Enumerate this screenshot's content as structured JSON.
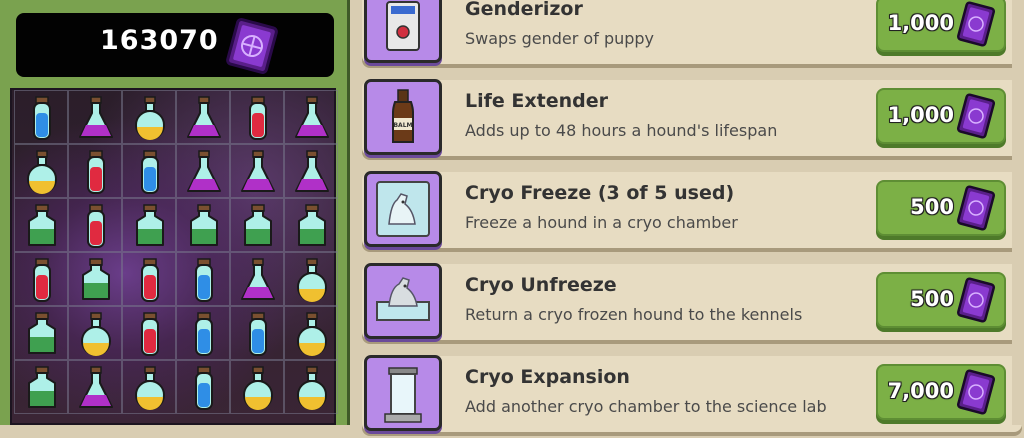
{
  "score": {
    "value": "163070",
    "currency_icon": "purple-card-icon"
  },
  "board": {
    "rows": [
      [
        "blue-vial",
        "purple-flask",
        "yellow-round",
        "purple-flask",
        "red-vial",
        "purple-flask"
      ],
      [
        "yellow-round",
        "red-vial",
        "blue-vial",
        "purple-flask",
        "purple-flask",
        "purple-flask"
      ],
      [
        "green-bottle",
        "red-vial",
        "green-bottle",
        "green-bottle",
        "green-bottle",
        "green-bottle"
      ],
      [
        "red-vial",
        "green-bottle",
        "red-vial",
        "blue-vial",
        "purple-flask",
        "yellow-round"
      ],
      [
        "green-bottle",
        "yellow-round",
        "red-vial",
        "blue-vial",
        "blue-vial",
        "yellow-round"
      ],
      [
        "green-bottle",
        "purple-flask",
        "yellow-round",
        "blue-vial",
        "yellow-round",
        "yellow-round"
      ]
    ],
    "colors": {
      "blue": "#2f8ee6",
      "purple": "#b030c8",
      "yellow": "#f0c030",
      "red": "#e02a40",
      "green": "#3fa050",
      "glass": "#aef0e8"
    }
  },
  "shop": {
    "items": [
      {
        "name": "Genderizor",
        "desc": "Swaps gender of puppy",
        "price": "1,000",
        "icon": "genderizor-machine-icon"
      },
      {
        "name": "Life Extender",
        "desc": "Adds up to 48 hours a hound's lifespan",
        "price": "1,000",
        "icon": "bottle-icon",
        "icon_label": "BALM"
      },
      {
        "name": "Cryo Freeze (3 of 5 used)",
        "desc": "Freeze a hound in a cryo chamber",
        "price": "500",
        "icon": "frozen-dog-icon"
      },
      {
        "name": "Cryo Unfreeze",
        "desc": "Return a cryo frozen hound to the kennels",
        "price": "500",
        "icon": "thawing-dog-icon"
      },
      {
        "name": "Cryo Expansion",
        "desc": "Add another cryo chamber to the science lab",
        "price": "7,000",
        "icon": "cryo-chamber-icon"
      }
    ],
    "accent": "#7cb046",
    "icon_bg": "#b78ae8"
  }
}
